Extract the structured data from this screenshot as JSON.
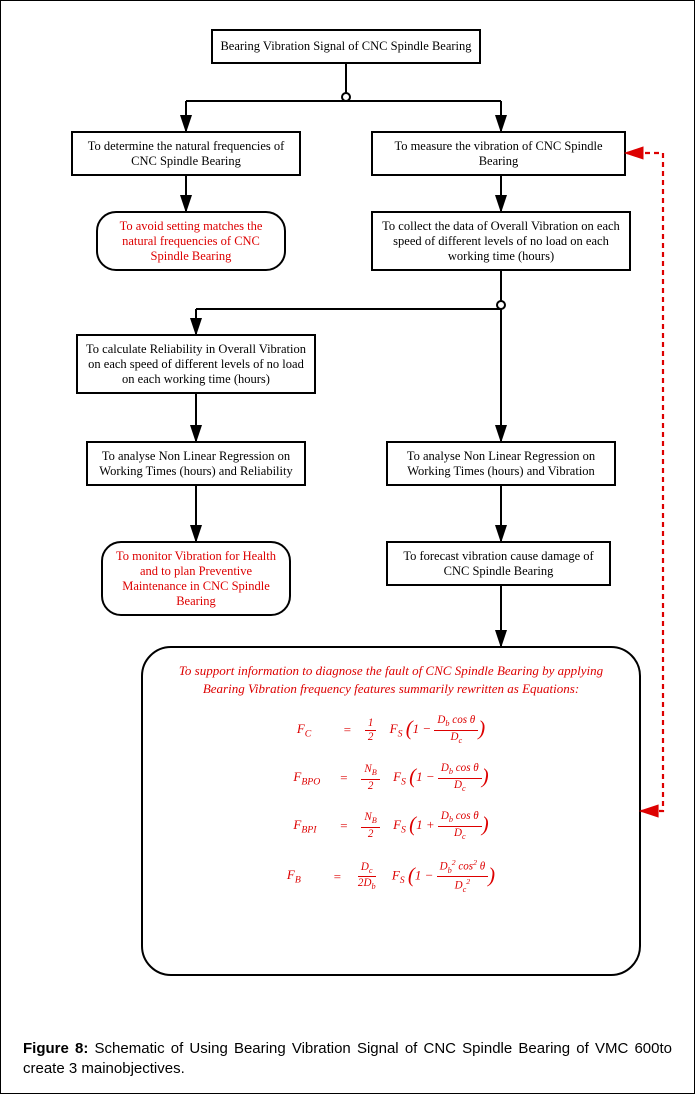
{
  "boxes": {
    "b0": "Bearing Vibration Signal of CNC Spindle Bearing",
    "b1": "To determine the natural frequencies of CNC Spindle Bearing",
    "b2": "To measure the vibration of CNC Spindle Bearing",
    "b3": "To avoid setting matches the natural frequencies of CNC Spindle Bearing",
    "b4": "To collect the data of Overall Vibration on each speed of different levels of no load on each working time (hours)",
    "b5": "To calculate Reliability in Overall Vibration on each speed of different levels of no load on each working time (hours)",
    "b6": "To analyse Non Linear Regression on Working Times (hours) and Reliability",
    "b7": "To analyse Non Linear Regression on Working Times (hours) and Vibration",
    "b8": "To forecast vibration cause damage of CNC Spindle Bearing",
    "b9": "To monitor Vibration for Health and to plan Preventive Maintenance in CNC Spindle Bearing",
    "eqIntro": "To support information to diagnose the fault of CNC Spindle Bearing by applying Bearing Vibration frequency features summarily rewritten as Equations:"
  },
  "caption": {
    "label": "Figure 8:",
    "text": "Schematic of Using Bearing Vibration Signal of CNC Spindle Bearing of VMC 600to create 3 mainobjectives."
  },
  "chart_data": {
    "type": "flowchart",
    "nodes": [
      {
        "id": "b0",
        "shape": "rect",
        "text": "Bearing Vibration Signal of CNC Spindle Bearing"
      },
      {
        "id": "b1",
        "shape": "rect",
        "text": "To determine the natural frequencies of CNC Spindle Bearing"
      },
      {
        "id": "b2",
        "shape": "rect",
        "text": "To measure the vibration of CNC Spindle Bearing"
      },
      {
        "id": "b3",
        "shape": "round",
        "color": "red",
        "text": "To avoid setting matches the natural frequencies of CNC Spindle Bearing"
      },
      {
        "id": "b4",
        "shape": "rect",
        "text": "To collect the data of Overall Vibration on each speed of different levels of no load on each working time (hours)"
      },
      {
        "id": "b5",
        "shape": "rect",
        "text": "To calculate Reliability in Overall Vibration on each speed of different levels of no load on each working time (hours)"
      },
      {
        "id": "b6",
        "shape": "rect",
        "text": "To analyse Non Linear Regression on Working Times (hours) and Reliability"
      },
      {
        "id": "b7",
        "shape": "rect",
        "text": "To analyse Non Linear Regression on Working Times (hours) and Vibration"
      },
      {
        "id": "b8",
        "shape": "rect",
        "text": "To forecast vibration cause damage of CNC Spindle Bearing"
      },
      {
        "id": "b9",
        "shape": "round",
        "color": "red",
        "text": "To monitor Vibration for Health and to plan Preventive Maintenance in CNC Spindle Bearing"
      },
      {
        "id": "eq",
        "shape": "round",
        "color": "red",
        "text": "Equations F_C, F_BPO, F_BPI, F_B"
      }
    ],
    "edges": [
      {
        "from": "b0",
        "to": "b1"
      },
      {
        "from": "b0",
        "to": "b2"
      },
      {
        "from": "b1",
        "to": "b3"
      },
      {
        "from": "b2",
        "to": "b4"
      },
      {
        "from": "b4",
        "to": "b5"
      },
      {
        "from": "b4",
        "to": "b7"
      },
      {
        "from": "b5",
        "to": "b6"
      },
      {
        "from": "b6",
        "to": "b9"
      },
      {
        "from": "b7",
        "to": "b8"
      },
      {
        "from": "b8",
        "to": "eq"
      },
      {
        "from": "eq",
        "to": "b2",
        "style": "dashed-red",
        "dir": "both"
      }
    ],
    "equations": [
      "F_C = 1/2 * F_S * (1 - (D_b cosθ)/D_c)",
      "F_BPO = N_B/2 * F_S * (1 - (D_b cosθ)/D_c)",
      "F_BPI = N_B/2 * F_S * (1 + (D_b cosθ)/D_c)",
      "F_B = D_c/(2 D_b) * F_S * (1 - (D_b^2 cos^2 θ)/D_c^2)"
    ]
  }
}
